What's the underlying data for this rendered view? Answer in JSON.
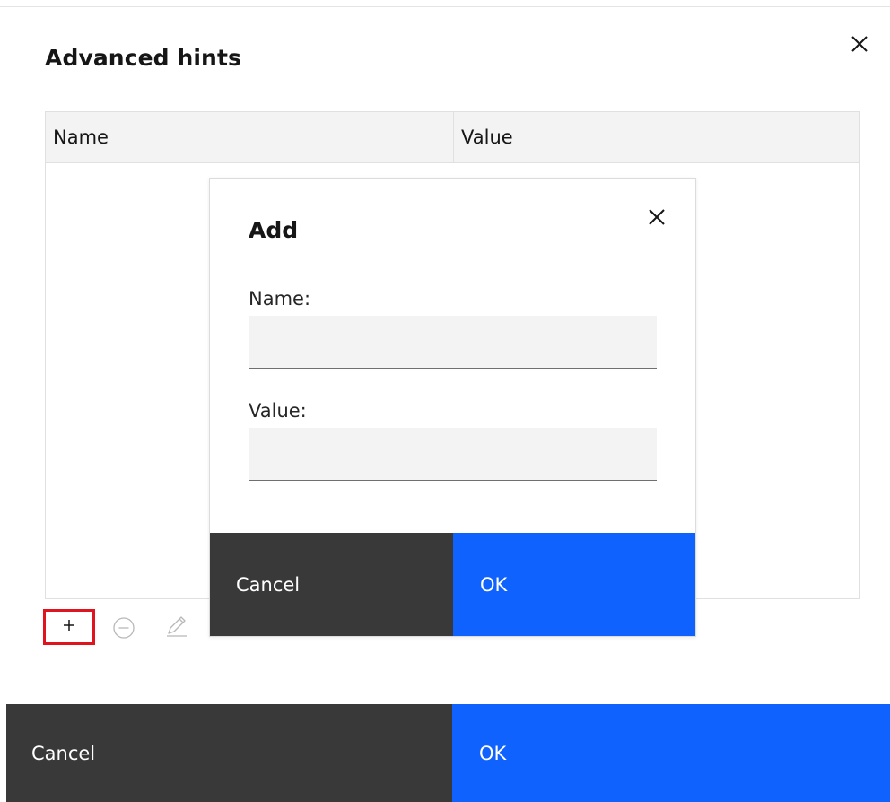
{
  "main_dialog": {
    "title": "Advanced hints",
    "close_icon": "close-icon",
    "table": {
      "columns": [
        "Name",
        "Value"
      ],
      "rows": []
    },
    "toolbar": {
      "add_icon": "plus-icon",
      "remove_icon": "minus-circle-icon",
      "edit_icon": "pencil-icon",
      "add_highlight_color": "#e0141e"
    },
    "footer": {
      "cancel_label": "Cancel",
      "ok_label": "OK"
    }
  },
  "add_dialog": {
    "title": "Add",
    "close_icon": "close-icon",
    "name_label": "Name:",
    "name_value": "",
    "value_label": "Value:",
    "value_value": "",
    "cancel_label": "Cancel",
    "ok_label": "OK"
  },
  "colors": {
    "primary": "#0f62fe",
    "secondary": "#393939",
    "field_background": "#f3f3f3"
  }
}
